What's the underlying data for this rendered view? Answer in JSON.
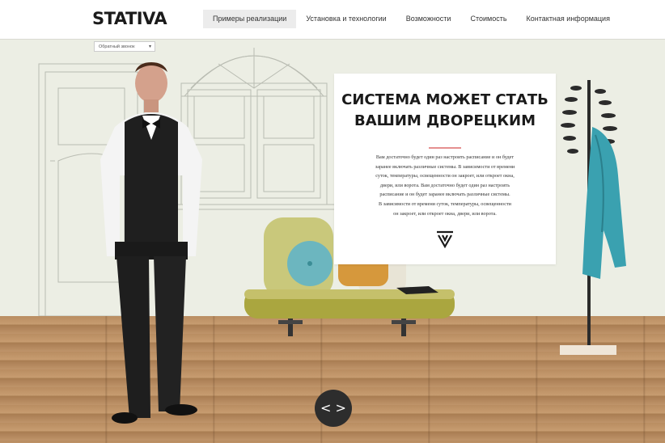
{
  "brand": {
    "logo": "STATIVA"
  },
  "nav": {
    "items": [
      {
        "label": "Примеры реализации",
        "active": true
      },
      {
        "label": "Установка и технологии"
      },
      {
        "label": "Возможности"
      },
      {
        "label": "Стоимость"
      },
      {
        "label": "Контактная информация"
      }
    ]
  },
  "callback": {
    "label": "Обратный звонок"
  },
  "hero": {
    "title_line1": "СИСТЕМА МОЖЕТ СТАТЬ",
    "title_line2": "ВАШИМ ДВОРЕЦКИМ",
    "text_lines": [
      "Вам достаточно будет один раз настроить расписание и он будет",
      "заранее включать различные системы. В зависимости от времени",
      "суток, температуры, освещенности он закроет, или откроет окна,",
      "двери, или ворота. Вам достаточно будет один раз настроить",
      "расписание и он будет заранее включать различные системы.",
      "В зависимости от времени суток, температуры, освещенности",
      "он закроет, или откроет окна, двери, или ворота."
    ]
  },
  "slider": {
    "arrows_label": "< >"
  },
  "colors": {
    "accent_line": "#e58f8f",
    "nav_active_bg": "#ececec",
    "wall": "#eceee4",
    "floor": "#bf946a"
  },
  "icons": {
    "logo_mark": "stativa-v-icon",
    "caret": "chevron-down-icon"
  }
}
